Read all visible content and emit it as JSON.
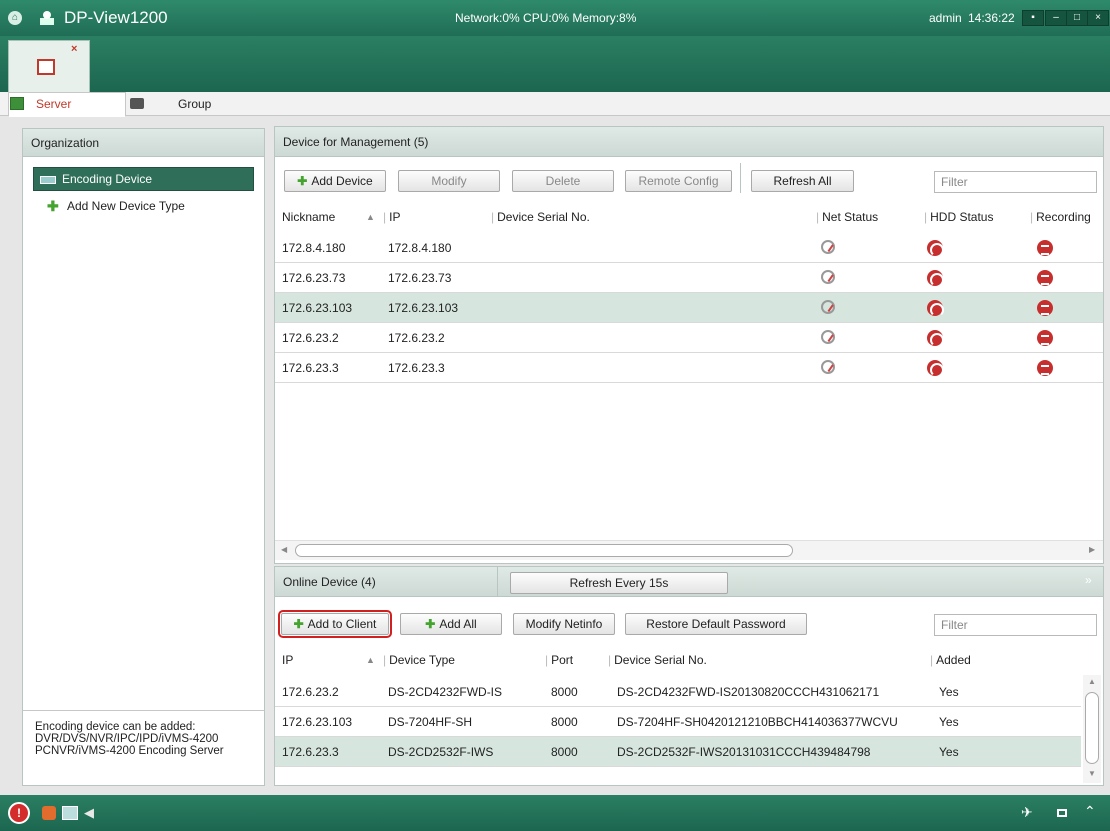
{
  "titlebar": {
    "app_title": "DP-View1200",
    "stats": "Network:0% CPU:0% Memory:8%",
    "user": "admin",
    "time": "14:36:22",
    "minimize": "–",
    "maximize": "□",
    "close": "×"
  },
  "server_tabs": [
    {
      "label": "Server"
    },
    {
      "label": "Group"
    }
  ],
  "organization": {
    "title": "Organization",
    "items": [
      {
        "label": "Encoding Device",
        "selected": true
      },
      {
        "label": "Add New Device Type",
        "selected": false
      }
    ],
    "info": [
      "Encoding device can be added:",
      "DVR/DVS/NVR/IPC/IPD/iVMS-4200",
      "PCNVR/iVMS-4200 Encoding Server"
    ]
  },
  "management": {
    "title": "Device for Management (5)",
    "buttons": {
      "add": "Add Device",
      "modify": "Modify",
      "delete": "Delete",
      "remote": "Remote Config",
      "refresh": "Refresh All"
    },
    "filter_placeholder": "Filter",
    "columns": [
      "Nickname",
      "IP",
      "Device Serial No.",
      "Net Status",
      "HDD Status",
      "Recording"
    ],
    "rows": [
      {
        "nickname": "172.8.4.180",
        "ip": "172.8.4.180",
        "serial": ""
      },
      {
        "nickname": "172.6.23.73",
        "ip": "172.6.23.73",
        "serial": ""
      },
      {
        "nickname": "172.6.23.103",
        "ip": "172.6.23.103",
        "serial": "",
        "selected": true
      },
      {
        "nickname": "172.6.23.2",
        "ip": "172.6.23.2",
        "serial": ""
      },
      {
        "nickname": "172.6.23.3",
        "ip": "172.6.23.3",
        "serial": ""
      }
    ]
  },
  "online": {
    "title": "Online Device (4)",
    "refresh_label": "Refresh Every 15s",
    "buttons": {
      "add_client": "Add to Client",
      "add_all": "Add All",
      "modify_netinfo": "Modify Netinfo",
      "restore": "Restore Default Password"
    },
    "filter_placeholder": "Filter",
    "columns": [
      "IP",
      "Device Type",
      "Port",
      "Device Serial No.",
      "Added"
    ],
    "rows": [
      {
        "ip": "172.6.23.2",
        "type": "DS-2CD4232FWD-IS",
        "port": "8000",
        "serial": "DS-2CD4232FWD-IS20130820CCCH431062171",
        "added": "Yes"
      },
      {
        "ip": "172.6.23.103",
        "type": "DS-7204HF-SH",
        "port": "8000",
        "serial": "DS-7204HF-SH0420121210BBCH414036377WCVU",
        "added": "Yes"
      },
      {
        "ip": "172.6.23.3",
        "type": "DS-2CD2532F-IWS",
        "port": "8000",
        "serial": "DS-2CD2532F-IWS20131031CCCH439484798",
        "added": "Yes",
        "selected": true
      }
    ]
  }
}
